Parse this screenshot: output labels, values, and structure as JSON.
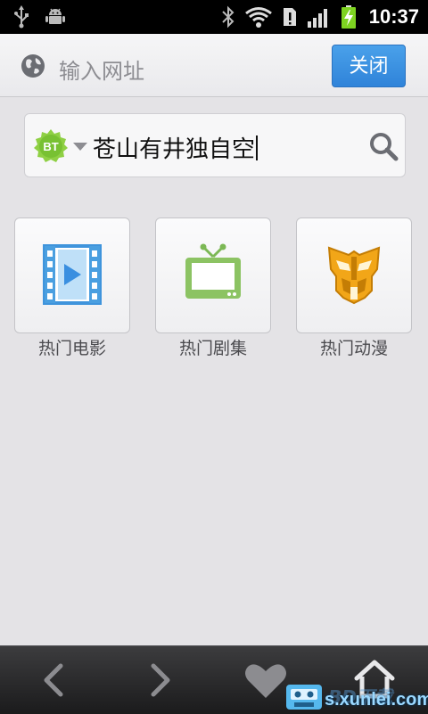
{
  "status_bar": {
    "time": "10:37",
    "icons": [
      "usb-icon",
      "android-debug-icon",
      "bluetooth-icon",
      "wifi-icon",
      "sim-alert-icon",
      "signal-icon",
      "battery-charging-icon"
    ]
  },
  "url_bar": {
    "placeholder": "输入网址",
    "close_label": "关闭",
    "icon": "globe-icon"
  },
  "search": {
    "engine_badge": "BT",
    "query": "苍山有井独自空",
    "icon": "search-icon"
  },
  "categories": [
    {
      "label": "热门电影",
      "icon": "film-icon"
    },
    {
      "label": "热门剧集",
      "icon": "tv-icon"
    },
    {
      "label": "热门动漫",
      "icon": "transformers-icon"
    }
  ],
  "toolbar": {
    "icons": [
      "back-icon",
      "forward-icon",
      "favorites-heart-icon",
      "home-icon"
    ]
  },
  "watermark": {
    "text": "s.xunlei.com",
    "faint_text": "BD下载"
  },
  "colors": {
    "accent_blue": "#3a8fe0",
    "bt_green": "#7cc63b",
    "film_blue": "#4a9fe0",
    "tv_green": "#8cc363",
    "transformer_orange": "#f2a618"
  }
}
